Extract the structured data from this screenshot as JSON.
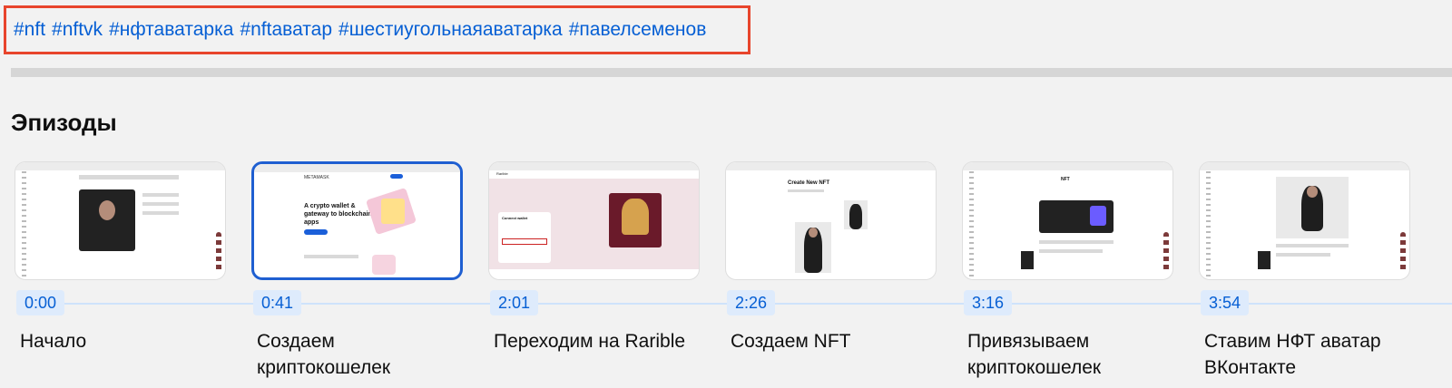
{
  "hashtags": [
    "#nft",
    "#nftvk",
    "#нфтаватарка",
    "#nftаватар",
    "#шестиугольнаяаватарка",
    "#павелсеменов"
  ],
  "section_title": "Эпизоды",
  "episodes": [
    {
      "time": "0:00",
      "title": "Начало"
    },
    {
      "time": "0:41",
      "title": "Создаем криптокошелек"
    },
    {
      "time": "2:01",
      "title": "Переходим на Rarible"
    },
    {
      "time": "2:26",
      "title": "Создаем NFT"
    },
    {
      "time": "3:16",
      "title": "Привязываем криптокошелек"
    },
    {
      "time": "3:54",
      "title": "Ставим НФТ аватар ВКонтакте"
    }
  ],
  "thumbnails": {
    "metamask": {
      "brand": "METAMASK",
      "headline": "A crypto wallet & gateway to blockchain apps"
    },
    "rarible": {
      "brand": "Rarible",
      "modal_title": "Connect wallet"
    },
    "create_nft": {
      "heading": "Create New NFT"
    },
    "vk_nft": {
      "title": "NFT"
    }
  },
  "colors": {
    "hashtag_link": "#065fd4",
    "highlight_border": "#e8452c",
    "active_thumb_border": "#1f5fd1",
    "timestamp_bg": "#deebfc",
    "background": "#f2f2f2"
  }
}
